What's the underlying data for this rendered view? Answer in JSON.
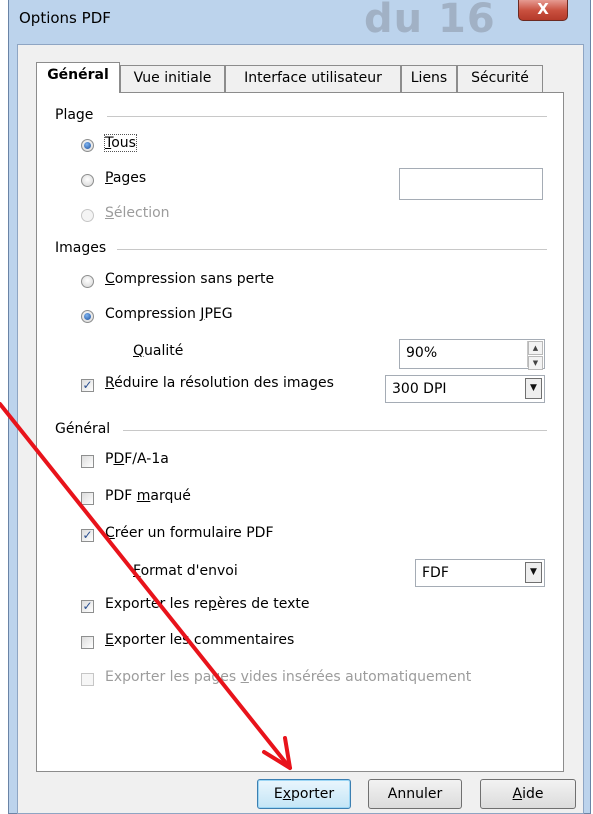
{
  "window": {
    "title": "Options PDF",
    "close_glyph": "X",
    "background_text": "du 16"
  },
  "tabs": [
    {
      "label": "Général",
      "active": true
    },
    {
      "label": "Vue initiale",
      "active": false
    },
    {
      "label": "Interface utilisateur",
      "active": false
    },
    {
      "label": "Liens",
      "active": false
    },
    {
      "label": "Sécurité",
      "active": false
    }
  ],
  "plage": {
    "title": "Plage",
    "tous": {
      "label_key": "T",
      "label_rest": "ous",
      "selected": true
    },
    "pages": {
      "label_key": "P",
      "label_rest": "ages",
      "selected": false,
      "value": ""
    },
    "selection": {
      "label_key": "S",
      "label_rest": "élection",
      "selected": false,
      "disabled": true
    }
  },
  "images": {
    "title": "Images",
    "lossless": {
      "label_key": "C",
      "label_rest": "ompression sans perte",
      "selected": false
    },
    "jpeg": {
      "label_pre": "Compression ",
      "label_key": "J",
      "label_rest": "PEG",
      "selected": true
    },
    "quality": {
      "label_key": "Q",
      "label_rest": "ualité",
      "value": "90%"
    },
    "reduce": {
      "label_key": "R",
      "label_rest": "éduire la résolution des images",
      "checked": true,
      "value": "300 DPI"
    }
  },
  "general": {
    "title": "Général",
    "pdfa": {
      "label_pre": "P",
      "label_key": "D",
      "label_rest": "F/A-1a",
      "checked": false
    },
    "tagged": {
      "label_pre": "PDF ",
      "label_key": "m",
      "label_rest": "arqué",
      "checked": false
    },
    "form": {
      "label_key": "C",
      "label_rest": "réer un formulaire PDF",
      "checked": true
    },
    "submit_format": {
      "label_key": "F",
      "label_rest": "ormat d'envoi",
      "value": "FDF"
    },
    "bookmarks": {
      "label_pre": "Exporter les re",
      "label_key": "p",
      "label_rest": "ères de texte",
      "checked": true
    },
    "comments": {
      "label_key": "E",
      "label_rest": "xporter les commentaires",
      "checked": false
    },
    "blank_pages": {
      "label_pre": "Exporter les pages ",
      "label_key": "v",
      "label_rest": "ides insérées automatiquement",
      "checked": false,
      "disabled": true
    }
  },
  "buttons": {
    "export": {
      "label_pre": "E",
      "label_key": "x",
      "label_rest": "porter"
    },
    "cancel": {
      "label": "Annuler"
    },
    "help": {
      "label_key": "A",
      "label_rest": "ide"
    }
  },
  "colors": {
    "annotation_arrow": "#e8131b"
  },
  "icons": {
    "checkmark": "✓",
    "dropdown": "▼",
    "spin_up": "▲",
    "spin_down": "▼"
  }
}
